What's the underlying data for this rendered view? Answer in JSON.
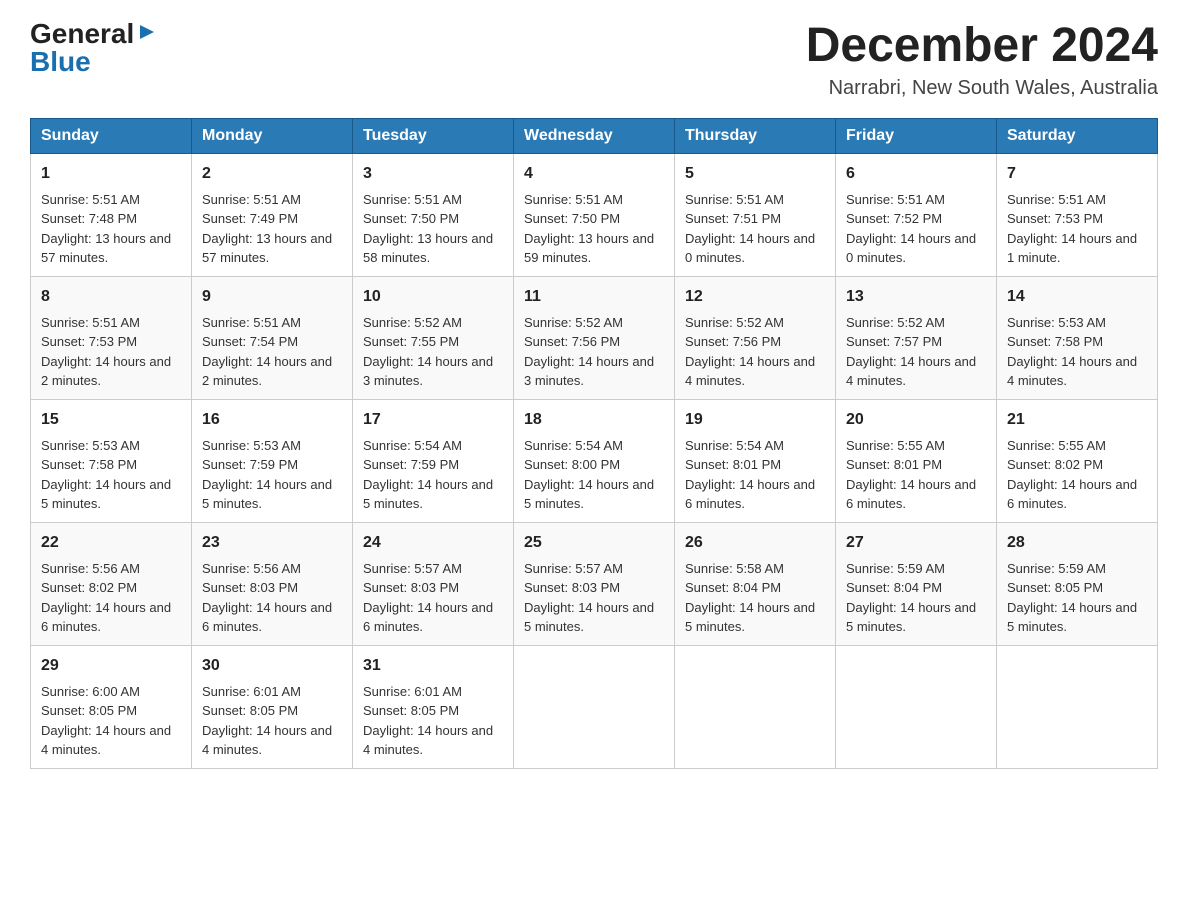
{
  "logo": {
    "general": "General",
    "arrow": "▶",
    "blue": "Blue"
  },
  "title": {
    "month": "December 2024",
    "location": "Narrabri, New South Wales, Australia"
  },
  "headers": [
    "Sunday",
    "Monday",
    "Tuesday",
    "Wednesday",
    "Thursday",
    "Friday",
    "Saturday"
  ],
  "weeks": [
    [
      {
        "day": "1",
        "sunrise": "5:51 AM",
        "sunset": "7:48 PM",
        "daylight": "13 hours and 57 minutes."
      },
      {
        "day": "2",
        "sunrise": "5:51 AM",
        "sunset": "7:49 PM",
        "daylight": "13 hours and 57 minutes."
      },
      {
        "day": "3",
        "sunrise": "5:51 AM",
        "sunset": "7:50 PM",
        "daylight": "13 hours and 58 minutes."
      },
      {
        "day": "4",
        "sunrise": "5:51 AM",
        "sunset": "7:50 PM",
        "daylight": "13 hours and 59 minutes."
      },
      {
        "day": "5",
        "sunrise": "5:51 AM",
        "sunset": "7:51 PM",
        "daylight": "14 hours and 0 minutes."
      },
      {
        "day": "6",
        "sunrise": "5:51 AM",
        "sunset": "7:52 PM",
        "daylight": "14 hours and 0 minutes."
      },
      {
        "day": "7",
        "sunrise": "5:51 AM",
        "sunset": "7:53 PM",
        "daylight": "14 hours and 1 minute."
      }
    ],
    [
      {
        "day": "8",
        "sunrise": "5:51 AM",
        "sunset": "7:53 PM",
        "daylight": "14 hours and 2 minutes."
      },
      {
        "day": "9",
        "sunrise": "5:51 AM",
        "sunset": "7:54 PM",
        "daylight": "14 hours and 2 minutes."
      },
      {
        "day": "10",
        "sunrise": "5:52 AM",
        "sunset": "7:55 PM",
        "daylight": "14 hours and 3 minutes."
      },
      {
        "day": "11",
        "sunrise": "5:52 AM",
        "sunset": "7:56 PM",
        "daylight": "14 hours and 3 minutes."
      },
      {
        "day": "12",
        "sunrise": "5:52 AM",
        "sunset": "7:56 PM",
        "daylight": "14 hours and 4 minutes."
      },
      {
        "day": "13",
        "sunrise": "5:52 AM",
        "sunset": "7:57 PM",
        "daylight": "14 hours and 4 minutes."
      },
      {
        "day": "14",
        "sunrise": "5:53 AM",
        "sunset": "7:58 PM",
        "daylight": "14 hours and 4 minutes."
      }
    ],
    [
      {
        "day": "15",
        "sunrise": "5:53 AM",
        "sunset": "7:58 PM",
        "daylight": "14 hours and 5 minutes."
      },
      {
        "day": "16",
        "sunrise": "5:53 AM",
        "sunset": "7:59 PM",
        "daylight": "14 hours and 5 minutes."
      },
      {
        "day": "17",
        "sunrise": "5:54 AM",
        "sunset": "7:59 PM",
        "daylight": "14 hours and 5 minutes."
      },
      {
        "day": "18",
        "sunrise": "5:54 AM",
        "sunset": "8:00 PM",
        "daylight": "14 hours and 5 minutes."
      },
      {
        "day": "19",
        "sunrise": "5:54 AM",
        "sunset": "8:01 PM",
        "daylight": "14 hours and 6 minutes."
      },
      {
        "day": "20",
        "sunrise": "5:55 AM",
        "sunset": "8:01 PM",
        "daylight": "14 hours and 6 minutes."
      },
      {
        "day": "21",
        "sunrise": "5:55 AM",
        "sunset": "8:02 PM",
        "daylight": "14 hours and 6 minutes."
      }
    ],
    [
      {
        "day": "22",
        "sunrise": "5:56 AM",
        "sunset": "8:02 PM",
        "daylight": "14 hours and 6 minutes."
      },
      {
        "day": "23",
        "sunrise": "5:56 AM",
        "sunset": "8:03 PM",
        "daylight": "14 hours and 6 minutes."
      },
      {
        "day": "24",
        "sunrise": "5:57 AM",
        "sunset": "8:03 PM",
        "daylight": "14 hours and 6 minutes."
      },
      {
        "day": "25",
        "sunrise": "5:57 AM",
        "sunset": "8:03 PM",
        "daylight": "14 hours and 5 minutes."
      },
      {
        "day": "26",
        "sunrise": "5:58 AM",
        "sunset": "8:04 PM",
        "daylight": "14 hours and 5 minutes."
      },
      {
        "day": "27",
        "sunrise": "5:59 AM",
        "sunset": "8:04 PM",
        "daylight": "14 hours and 5 minutes."
      },
      {
        "day": "28",
        "sunrise": "5:59 AM",
        "sunset": "8:05 PM",
        "daylight": "14 hours and 5 minutes."
      }
    ],
    [
      {
        "day": "29",
        "sunrise": "6:00 AM",
        "sunset": "8:05 PM",
        "daylight": "14 hours and 4 minutes."
      },
      {
        "day": "30",
        "sunrise": "6:01 AM",
        "sunset": "8:05 PM",
        "daylight": "14 hours and 4 minutes."
      },
      {
        "day": "31",
        "sunrise": "6:01 AM",
        "sunset": "8:05 PM",
        "daylight": "14 hours and 4 minutes."
      },
      null,
      null,
      null,
      null
    ]
  ]
}
